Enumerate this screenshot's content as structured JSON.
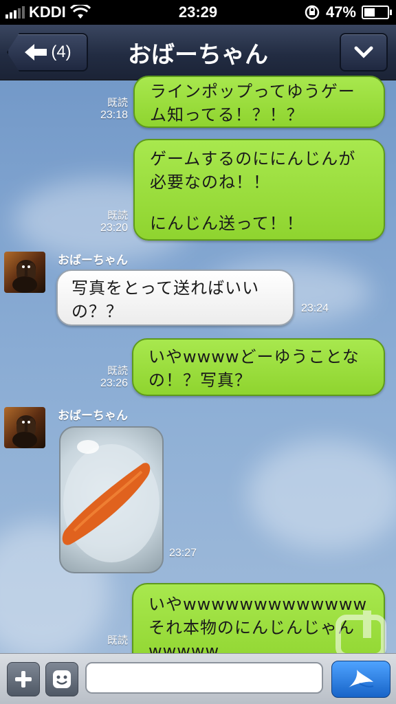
{
  "status_bar": {
    "carrier": "KDDI",
    "time": "23:29",
    "battery": "47%",
    "battery_level": 0.47
  },
  "header": {
    "back_count": "(4)",
    "title": "おばーちゃん"
  },
  "messages": [
    {
      "read": "既読",
      "time": "23:18",
      "lines": [
        "ラインポップってゆうゲー",
        "ム知ってる！？！？"
      ]
    },
    {
      "read": "既読",
      "time": "23:20",
      "lines": [
        "ゲームするのににんじんが",
        "必要なのね！！",
        "",
        "にんじん送って！！"
      ]
    },
    {
      "sender": "おばーちゃん",
      "time": "23:24",
      "lines": [
        "写真をとって送ればいい",
        "の？？"
      ]
    },
    {
      "read": "既読",
      "time": "23:26",
      "lines": [
        "いやwwwwどーゆうことな",
        "の！？写真？"
      ]
    },
    {
      "sender": "おばーちゃん",
      "time": "23:27"
    },
    {
      "read": "既読",
      "lines": [
        "いやwwwwwwwwwwwww",
        "それ本物のにんじんじゃん",
        "wwwww"
      ]
    }
  ],
  "input": {
    "placeholder": ""
  },
  "colors": {
    "bubble_green": "#a8e84e",
    "header_bg": "#222c42",
    "send_blue": "#1764c8"
  },
  "icons": [
    "signal-bars-icon",
    "wifi-icon",
    "rotation-lock-icon",
    "battery-icon",
    "back-arrow-icon",
    "chevron-down-icon",
    "plus-icon",
    "emoji-icon",
    "send-icon"
  ]
}
